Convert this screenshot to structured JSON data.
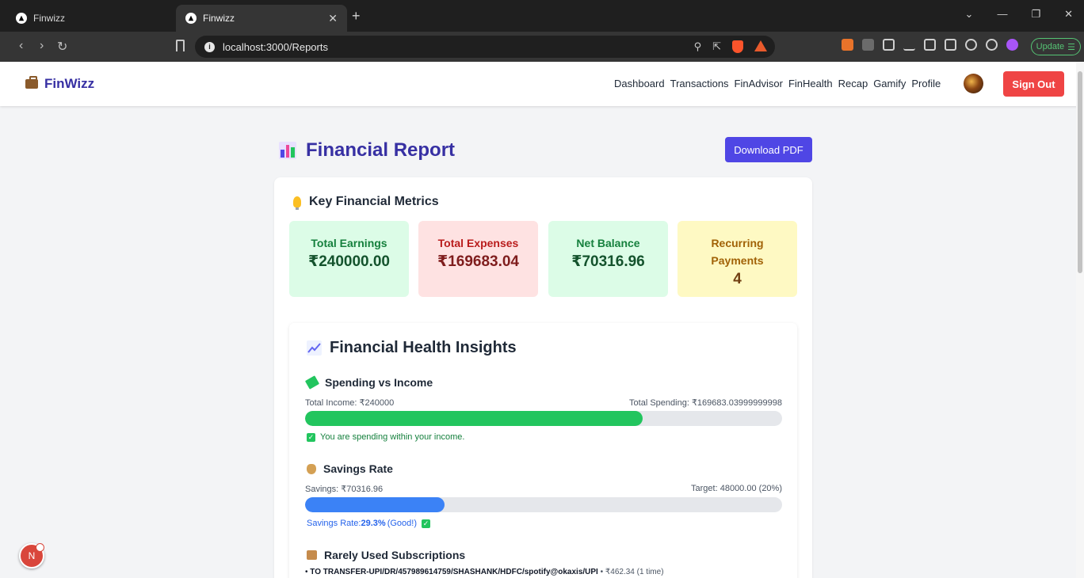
{
  "browser": {
    "tabs": [
      {
        "title": "Finwizz",
        "active": false
      },
      {
        "title": "Finwizz",
        "active": true
      }
    ],
    "url": "localhost:3000/Reports",
    "update_label": "Update"
  },
  "header": {
    "brand": "FinWizz",
    "nav": [
      "Dashboard",
      "Transactions",
      "FinAdvisor",
      "FinHealth",
      "Recap",
      "Gamify",
      "Profile"
    ],
    "signout_label": "Sign Out"
  },
  "report": {
    "title": "Financial Report",
    "download_label": "Download PDF",
    "metrics_title": "Key Financial Metrics",
    "metrics": [
      {
        "label": "Total Earnings",
        "value": "₹240000.00"
      },
      {
        "label": "Total Expenses",
        "value": "₹169683.04"
      },
      {
        "label": "Net Balance",
        "value": "₹70316.96"
      },
      {
        "label": "Recurring Payments",
        "value": "4"
      }
    ],
    "insights_title": "Financial Health Insights",
    "spending": {
      "title": "Spending vs Income",
      "income_text": "Total Income: ₹240000",
      "spending_text": "Total Spending: ₹169683.03999999998",
      "progress": 0.707,
      "note": "You are spending within your income."
    },
    "savings": {
      "title": "Savings Rate",
      "savings_text": "Savings: ₹70316.96",
      "target_text": "Target: 48000.00 (20%)",
      "progress": 0.293,
      "rate_prefix": "Savings Rate: ",
      "rate_value": "29.3%",
      "rate_suffix": " (Good!)"
    },
    "subscriptions": {
      "title": "Rarely Used Subscriptions",
      "items": [
        {
          "name": "TO TRANSFER-UPI/DR/457989614759/SHASHANK/HDFC/spotify@okaxis/UPI",
          "detail": " • ₹462.34 (1 time)"
        }
      ]
    }
  },
  "dev_badge": "N",
  "colors": {
    "brand": "#3730a3",
    "primary_button": "#4f46e5",
    "signout": "#ef4444",
    "spending_bar": "#22c55e",
    "savings_bar": "#3b82f6"
  }
}
